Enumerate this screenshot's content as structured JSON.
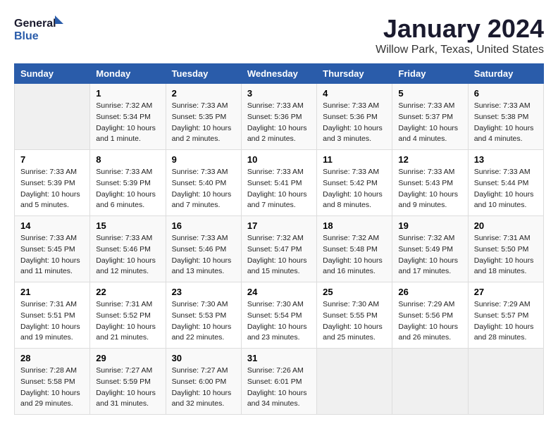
{
  "logo": {
    "line1": "General",
    "line2": "Blue"
  },
  "title": "January 2024",
  "subtitle": "Willow Park, Texas, United States",
  "days_of_week": [
    "Sunday",
    "Monday",
    "Tuesday",
    "Wednesday",
    "Thursday",
    "Friday",
    "Saturday"
  ],
  "weeks": [
    [
      {
        "day": "",
        "info": ""
      },
      {
        "day": "1",
        "info": "Sunrise: 7:32 AM\nSunset: 5:34 PM\nDaylight: 10 hours\nand 1 minute."
      },
      {
        "day": "2",
        "info": "Sunrise: 7:33 AM\nSunset: 5:35 PM\nDaylight: 10 hours\nand 2 minutes."
      },
      {
        "day": "3",
        "info": "Sunrise: 7:33 AM\nSunset: 5:36 PM\nDaylight: 10 hours\nand 2 minutes."
      },
      {
        "day": "4",
        "info": "Sunrise: 7:33 AM\nSunset: 5:36 PM\nDaylight: 10 hours\nand 3 minutes."
      },
      {
        "day": "5",
        "info": "Sunrise: 7:33 AM\nSunset: 5:37 PM\nDaylight: 10 hours\nand 4 minutes."
      },
      {
        "day": "6",
        "info": "Sunrise: 7:33 AM\nSunset: 5:38 PM\nDaylight: 10 hours\nand 4 minutes."
      }
    ],
    [
      {
        "day": "7",
        "info": "Sunrise: 7:33 AM\nSunset: 5:39 PM\nDaylight: 10 hours\nand 5 minutes."
      },
      {
        "day": "8",
        "info": "Sunrise: 7:33 AM\nSunset: 5:39 PM\nDaylight: 10 hours\nand 6 minutes."
      },
      {
        "day": "9",
        "info": "Sunrise: 7:33 AM\nSunset: 5:40 PM\nDaylight: 10 hours\nand 7 minutes."
      },
      {
        "day": "10",
        "info": "Sunrise: 7:33 AM\nSunset: 5:41 PM\nDaylight: 10 hours\nand 7 minutes."
      },
      {
        "day": "11",
        "info": "Sunrise: 7:33 AM\nSunset: 5:42 PM\nDaylight: 10 hours\nand 8 minutes."
      },
      {
        "day": "12",
        "info": "Sunrise: 7:33 AM\nSunset: 5:43 PM\nDaylight: 10 hours\nand 9 minutes."
      },
      {
        "day": "13",
        "info": "Sunrise: 7:33 AM\nSunset: 5:44 PM\nDaylight: 10 hours\nand 10 minutes."
      }
    ],
    [
      {
        "day": "14",
        "info": "Sunrise: 7:33 AM\nSunset: 5:45 PM\nDaylight: 10 hours\nand 11 minutes."
      },
      {
        "day": "15",
        "info": "Sunrise: 7:33 AM\nSunset: 5:46 PM\nDaylight: 10 hours\nand 12 minutes."
      },
      {
        "day": "16",
        "info": "Sunrise: 7:33 AM\nSunset: 5:46 PM\nDaylight: 10 hours\nand 13 minutes."
      },
      {
        "day": "17",
        "info": "Sunrise: 7:32 AM\nSunset: 5:47 PM\nDaylight: 10 hours\nand 15 minutes."
      },
      {
        "day": "18",
        "info": "Sunrise: 7:32 AM\nSunset: 5:48 PM\nDaylight: 10 hours\nand 16 minutes."
      },
      {
        "day": "19",
        "info": "Sunrise: 7:32 AM\nSunset: 5:49 PM\nDaylight: 10 hours\nand 17 minutes."
      },
      {
        "day": "20",
        "info": "Sunrise: 7:31 AM\nSunset: 5:50 PM\nDaylight: 10 hours\nand 18 minutes."
      }
    ],
    [
      {
        "day": "21",
        "info": "Sunrise: 7:31 AM\nSunset: 5:51 PM\nDaylight: 10 hours\nand 19 minutes."
      },
      {
        "day": "22",
        "info": "Sunrise: 7:31 AM\nSunset: 5:52 PM\nDaylight: 10 hours\nand 21 minutes."
      },
      {
        "day": "23",
        "info": "Sunrise: 7:30 AM\nSunset: 5:53 PM\nDaylight: 10 hours\nand 22 minutes."
      },
      {
        "day": "24",
        "info": "Sunrise: 7:30 AM\nSunset: 5:54 PM\nDaylight: 10 hours\nand 23 minutes."
      },
      {
        "day": "25",
        "info": "Sunrise: 7:30 AM\nSunset: 5:55 PM\nDaylight: 10 hours\nand 25 minutes."
      },
      {
        "day": "26",
        "info": "Sunrise: 7:29 AM\nSunset: 5:56 PM\nDaylight: 10 hours\nand 26 minutes."
      },
      {
        "day": "27",
        "info": "Sunrise: 7:29 AM\nSunset: 5:57 PM\nDaylight: 10 hours\nand 28 minutes."
      }
    ],
    [
      {
        "day": "28",
        "info": "Sunrise: 7:28 AM\nSunset: 5:58 PM\nDaylight: 10 hours\nand 29 minutes."
      },
      {
        "day": "29",
        "info": "Sunrise: 7:27 AM\nSunset: 5:59 PM\nDaylight: 10 hours\nand 31 minutes."
      },
      {
        "day": "30",
        "info": "Sunrise: 7:27 AM\nSunset: 6:00 PM\nDaylight: 10 hours\nand 32 minutes."
      },
      {
        "day": "31",
        "info": "Sunrise: 7:26 AM\nSunset: 6:01 PM\nDaylight: 10 hours\nand 34 minutes."
      },
      {
        "day": "",
        "info": ""
      },
      {
        "day": "",
        "info": ""
      },
      {
        "day": "",
        "info": ""
      }
    ]
  ]
}
